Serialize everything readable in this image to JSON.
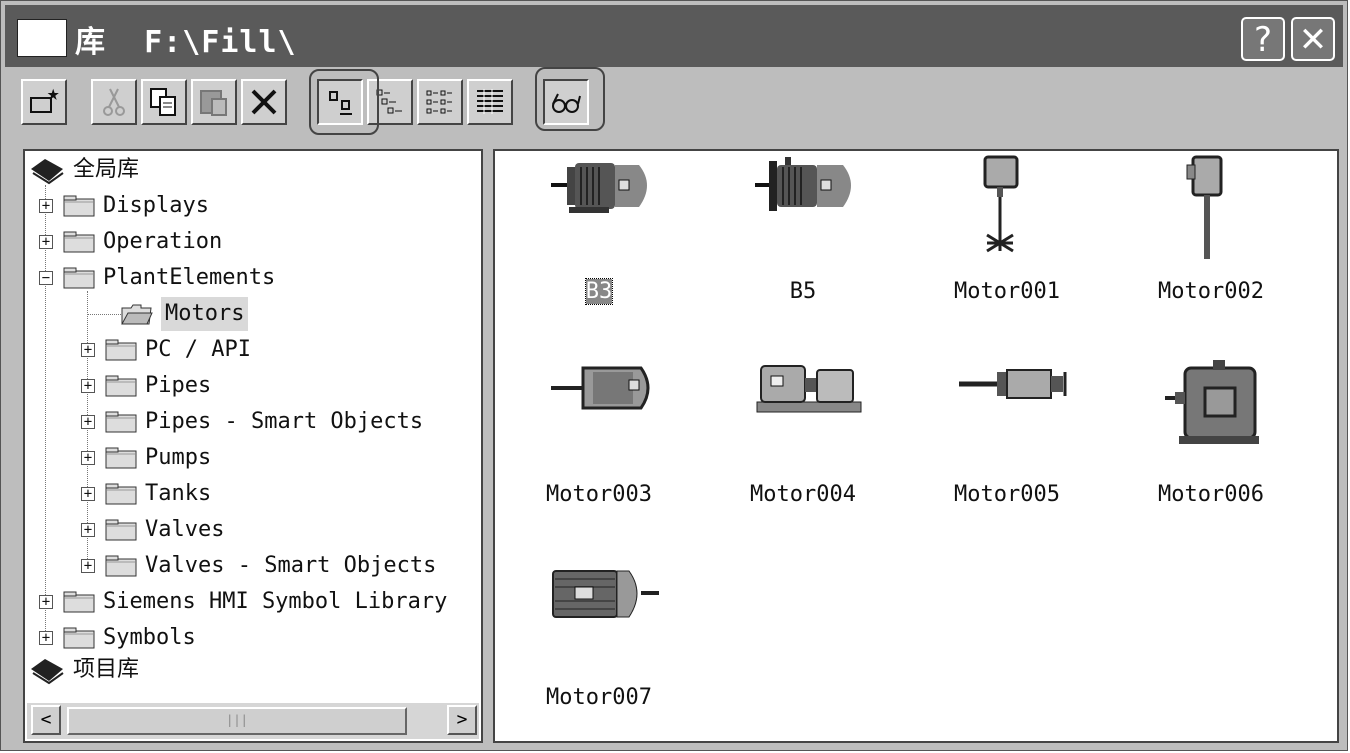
{
  "window": {
    "title_char": "库",
    "path": "F:\\Fill\\",
    "help_label": "?",
    "close_label": "✕"
  },
  "toolbar": {
    "buttons": [
      {
        "name": "new-object-button",
        "icon": "sparkle-folder-icon"
      },
      {
        "name": "cut-button",
        "icon": "scissors-icon",
        "enabled": false
      },
      {
        "name": "copy-button",
        "icon": "copy-icon"
      },
      {
        "name": "paste-button",
        "icon": "paste-icon",
        "enabled": false
      },
      {
        "name": "delete-button",
        "icon": "delete-x-icon"
      },
      {
        "name": "large-icons-view-button",
        "icon": "large-icons-icon",
        "pressed": true
      },
      {
        "name": "small-icons-view-button",
        "icon": "small-icons-icon"
      },
      {
        "name": "list-view-button",
        "icon": "list-icon"
      },
      {
        "name": "details-view-button",
        "icon": "details-icon"
      },
      {
        "name": "preview-button",
        "icon": "glasses-icon"
      }
    ]
  },
  "tree": {
    "global_root": "全局库",
    "items": [
      {
        "label": "Displays",
        "expander": "+",
        "level": 1
      },
      {
        "label": "Operation",
        "expander": "+",
        "level": 1
      },
      {
        "label": "PlantElements",
        "expander": "−",
        "level": 1
      },
      {
        "label": "Motors",
        "expander": "",
        "level": 2,
        "selected": true
      },
      {
        "label": "PC / API",
        "expander": "+",
        "level": 2
      },
      {
        "label": "Pipes",
        "expander": "+",
        "level": 2
      },
      {
        "label": "Pipes - Smart Objects",
        "expander": "+",
        "level": 2
      },
      {
        "label": "Pumps",
        "expander": "+",
        "level": 2
      },
      {
        "label": "Tanks",
        "expander": "+",
        "level": 2
      },
      {
        "label": "Valves",
        "expander": "+",
        "level": 2
      },
      {
        "label": "Valves - Smart Objects",
        "expander": "+",
        "level": 2
      },
      {
        "label": "Siemens HMI Symbol Library",
        "expander": "+",
        "level": 1
      },
      {
        "label": "Symbols",
        "expander": "+",
        "level": 1
      }
    ],
    "project_root": "项目库",
    "scroll_left": "<",
    "scroll_right": ">",
    "scroll_thumb": "|||"
  },
  "objects": [
    {
      "label": "B3",
      "selected": true,
      "icon": "motor-b3-icon"
    },
    {
      "label": "B5",
      "icon": "motor-b5-icon"
    },
    {
      "label": "Motor001",
      "icon": "agitator-motor-icon"
    },
    {
      "label": "Motor002",
      "icon": "vertical-motor-icon"
    },
    {
      "label": "Motor003",
      "icon": "shaft-motor-icon"
    },
    {
      "label": "Motor004",
      "icon": "motor-pump-skid-icon"
    },
    {
      "label": "Motor005",
      "icon": "small-motor-icon"
    },
    {
      "label": "Motor006",
      "icon": "large-motor-icon"
    },
    {
      "label": "Motor007",
      "icon": "finned-motor-icon"
    }
  ]
}
